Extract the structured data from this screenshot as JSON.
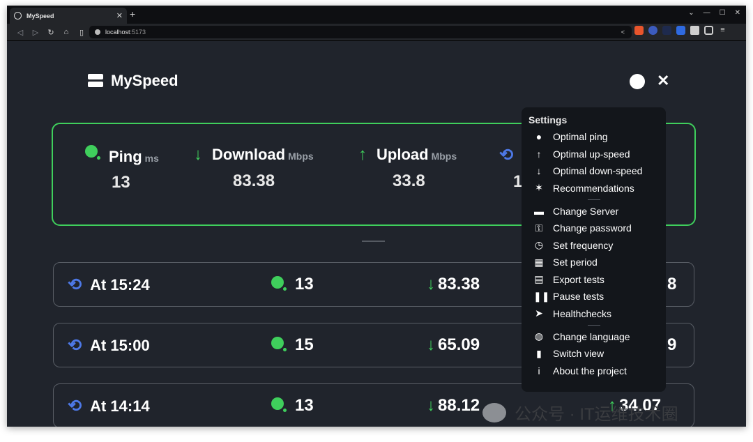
{
  "browser": {
    "tab_title": "MySpeed",
    "tab_close": "✕",
    "new_tab": "+",
    "url_host": "localhost",
    "url_port": ":5173"
  },
  "header": {
    "title": "MySpeed"
  },
  "summary": {
    "ping": {
      "label": "Ping",
      "unit": "ms",
      "value": "13"
    },
    "download": {
      "label": "Download",
      "unit": "Mbps",
      "value": "83.38"
    },
    "upload": {
      "label": "Upload",
      "unit": "Mbps",
      "value": "33.8"
    },
    "time": {
      "value": "1"
    }
  },
  "tests": [
    {
      "time": "At 15:24",
      "ping": "13",
      "down": "83.38",
      "up": "8"
    },
    {
      "time": "At 15:00",
      "ping": "15",
      "down": "65.09",
      "up": "9"
    },
    {
      "time": "At 14:14",
      "ping": "13",
      "down": "88.12",
      "up": "34.07"
    }
  ],
  "menu": {
    "title": "Settings",
    "group1": [
      "Optimal ping",
      "Optimal up-speed",
      "Optimal down-speed",
      "Recommendations"
    ],
    "group2": [
      "Change Server",
      "Change password",
      "Set frequency",
      "Set period",
      "Export tests",
      "Pause tests",
      "Healthchecks"
    ],
    "group3": [
      "Change language",
      "Switch view",
      "About the project"
    ]
  },
  "watermark": "公众号 · IT运维技术圈",
  "colors": {
    "accent_green": "#3fcf5c",
    "accent_blue": "#4d78e6",
    "background": "#20242c",
    "menu_bg": "#13161b"
  }
}
